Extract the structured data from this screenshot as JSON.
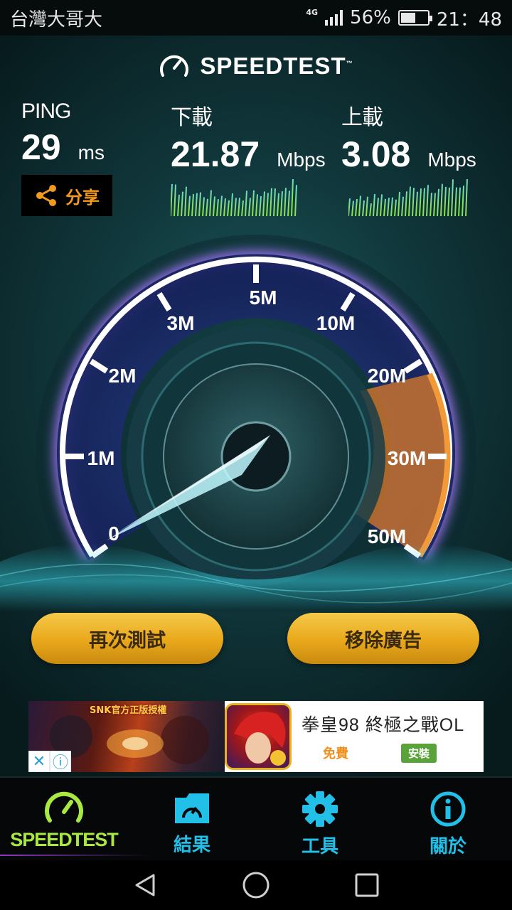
{
  "status_bar": {
    "carrier": "台灣大哥大",
    "network": "4G",
    "battery": "56%",
    "battery_level": 0.56,
    "time": "21：48"
  },
  "header": {
    "brand": "SPEEDTEST",
    "trademark": "™"
  },
  "ping": {
    "label": "PING",
    "value": "29",
    "unit": "ms"
  },
  "download": {
    "label": "下載",
    "value": "21.87",
    "unit": "Mbps"
  },
  "upload": {
    "label": "上載",
    "value": "3.08",
    "unit": "Mbps"
  },
  "share": {
    "label": "分享"
  },
  "gauge": {
    "ticks": [
      "0",
      "1M",
      "2M",
      "3M",
      "5M",
      "10M",
      "20M",
      "30M",
      "50M"
    ],
    "needle_value_mbps": 0,
    "colors": {
      "arc": "#ffffff",
      "glow": "#9b6cf0",
      "active": "#e8862a",
      "needle": "#bff8ff"
    }
  },
  "actions": {
    "retest": "再次測試",
    "remove_ads": "移除廣告"
  },
  "ad": {
    "banner_title": "SNK官方正版授權",
    "title": "拳皇98 終極之戰OL",
    "price": "免費",
    "install": "安裝"
  },
  "nav": {
    "items": [
      {
        "label": "SPEEDTEST",
        "icon": "speedometer-icon",
        "active": true
      },
      {
        "label": "結果",
        "icon": "folder-gauge-icon",
        "active": false
      },
      {
        "label": "工具",
        "icon": "gear-icon",
        "active": false
      },
      {
        "label": "關於",
        "icon": "info-icon",
        "active": false
      }
    ]
  },
  "colors": {
    "accent": "#22c0e8",
    "active_nav": "#a8e840",
    "button": "#e9a81a",
    "share_text": "#f29a1f"
  }
}
